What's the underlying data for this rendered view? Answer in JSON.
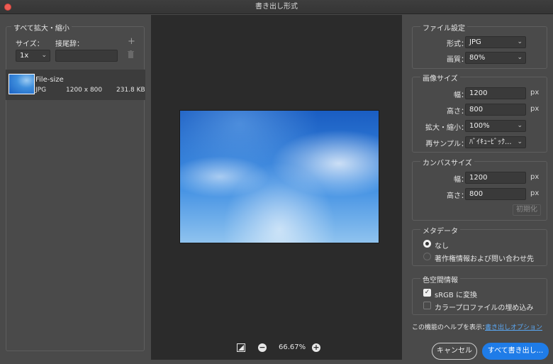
{
  "window": {
    "title": "書き出し形式"
  },
  "left": {
    "group_title": "すべて拡大・縮小",
    "size_label": "サイズ：",
    "suffix_label": "接尾辞：",
    "add_icon": "plus-icon",
    "delete_icon": "trash-icon",
    "scale_value": "1x",
    "suffix_value": "",
    "asset": {
      "name": "File-size",
      "format": "JPG",
      "dimensions": "1200 x 800",
      "filesize": "231.8 KB"
    }
  },
  "center": {
    "zoom_value": "66.67%"
  },
  "file_settings": {
    "title": "ファイル設定",
    "format_label": "形式：",
    "format_value": "JPG",
    "quality_label": "画質：",
    "quality_value": "80%"
  },
  "image_size": {
    "title": "画像サイズ",
    "width_label": "幅：",
    "width_value": "1200",
    "height_label": "高さ：",
    "height_value": "800",
    "unit": "px",
    "scale_label": "拡大・縮小：",
    "scale_value": "100%",
    "resample_label": "再サンプル：",
    "resample_value": "ﾊﾞｲｷｭｰﾋﾞｯｸ..."
  },
  "canvas_size": {
    "title": "カンバスサイズ",
    "width_label": "幅：",
    "width_value": "1200",
    "height_label": "高さ：",
    "height_value": "800",
    "unit": "px",
    "reset_label": "初期化"
  },
  "metadata": {
    "title": "メタデータ",
    "option_none": "なし",
    "option_copyright": "著作権情報および問い合わせ先"
  },
  "color_space": {
    "title": "色空間情報",
    "srgb_label": "sRGB に変換",
    "embed_label": "カラープロファイルの埋め込み"
  },
  "footer": {
    "help_text": "この機能のヘルプを表示：",
    "help_link": "書き出しオプション",
    "cancel_label": "キャンセル",
    "export_label": "すべて書き出し..."
  },
  "colors": {
    "accent": "#1f7ce8",
    "link": "#5aa7f2",
    "close": "#ee5c54"
  }
}
